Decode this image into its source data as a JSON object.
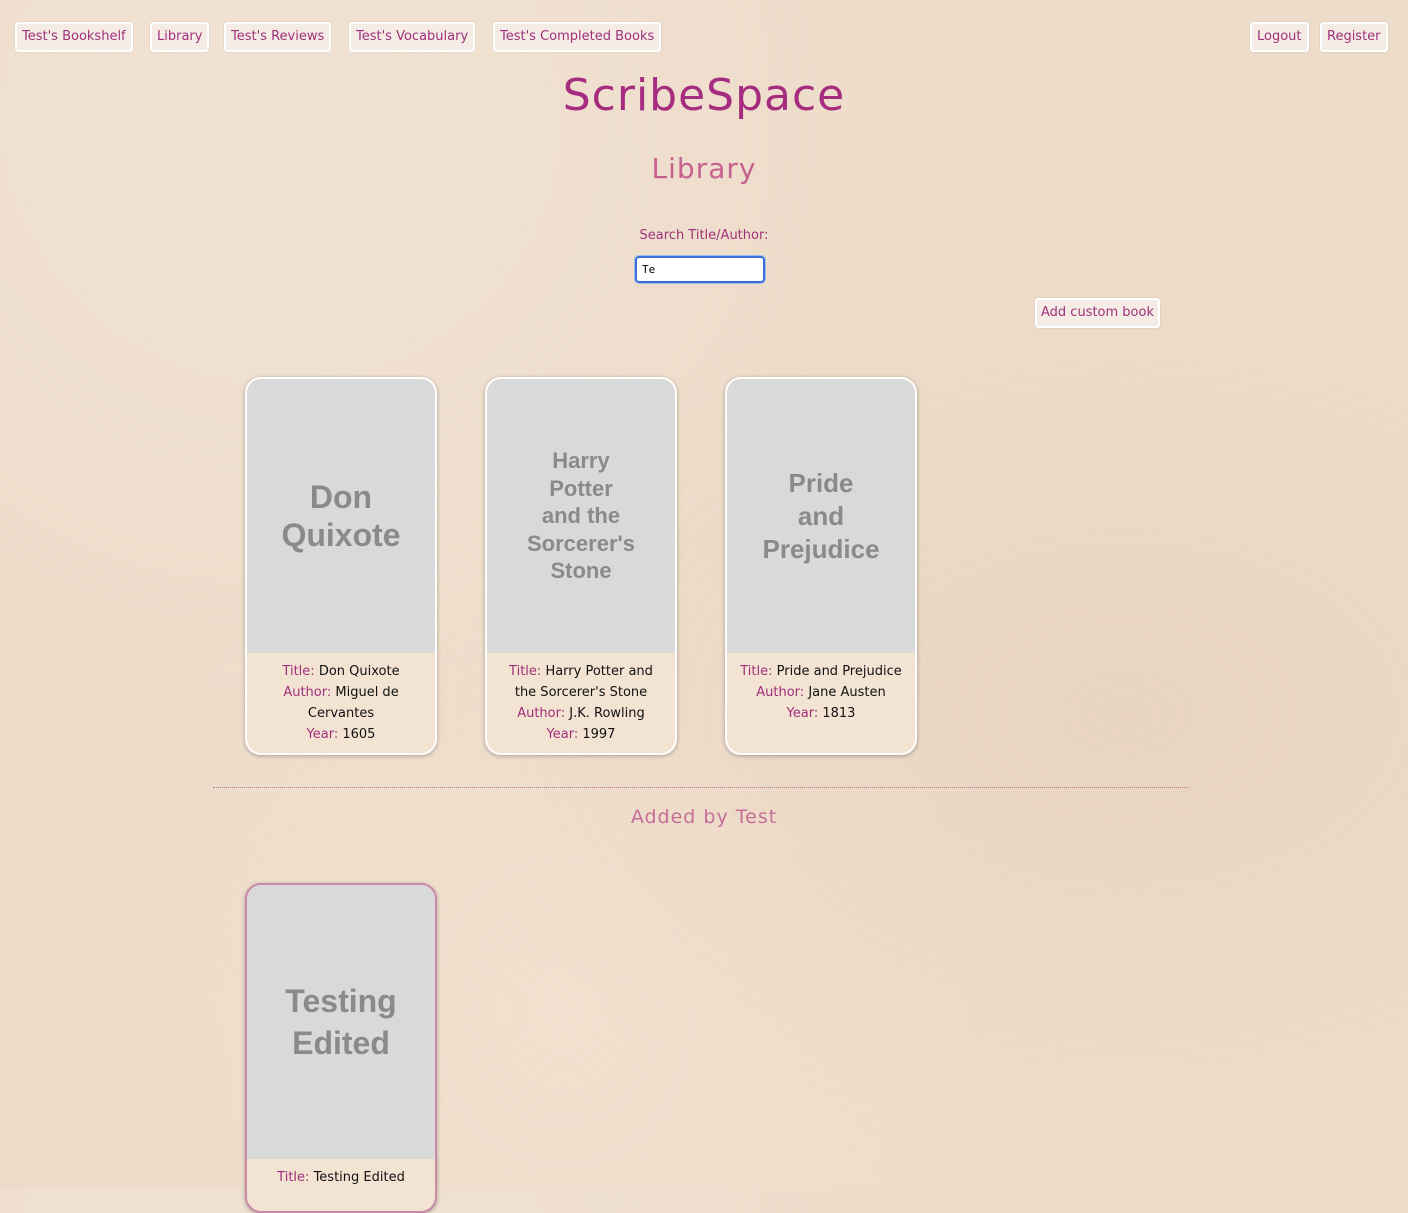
{
  "nav": {
    "bookshelf": "Test's Bookshelf",
    "library": "Library",
    "reviews": "Test's Reviews",
    "vocabulary": "Test's Vocabulary",
    "completed": "Test's Completed Books",
    "logout": "Logout",
    "register": "Register"
  },
  "logo": "ScribeSpace",
  "page_title": "Library",
  "search": {
    "label": "Search Title/Author:",
    "value": "Te"
  },
  "add_custom_book_label": "Add custom book",
  "labels": {
    "title": "Title:",
    "author": "Author:",
    "year": "Year:"
  },
  "books": [
    {
      "cover_text": "Don Quixote",
      "title": "Don Quixote",
      "author": "Miguel de Cervantes",
      "year": "1605"
    },
    {
      "cover_text": "Harry Potter and the Sorcerer's Stone",
      "title": "Harry Potter and the Sorcerer's Stone",
      "author": "J.K. Rowling",
      "year": "1997"
    },
    {
      "cover_text": "Pride and Prejudice",
      "title": "Pride and Prejudice",
      "author": "Jane Austen",
      "year": "1813"
    }
  ],
  "added_by_heading": "Added by Test",
  "custom_books": [
    {
      "cover_text": "Testing Edited",
      "title": "Testing Edited"
    }
  ],
  "colors": {
    "accent": "#a62c7f",
    "background": "#eedcca",
    "cover": "#d9d9d9"
  }
}
